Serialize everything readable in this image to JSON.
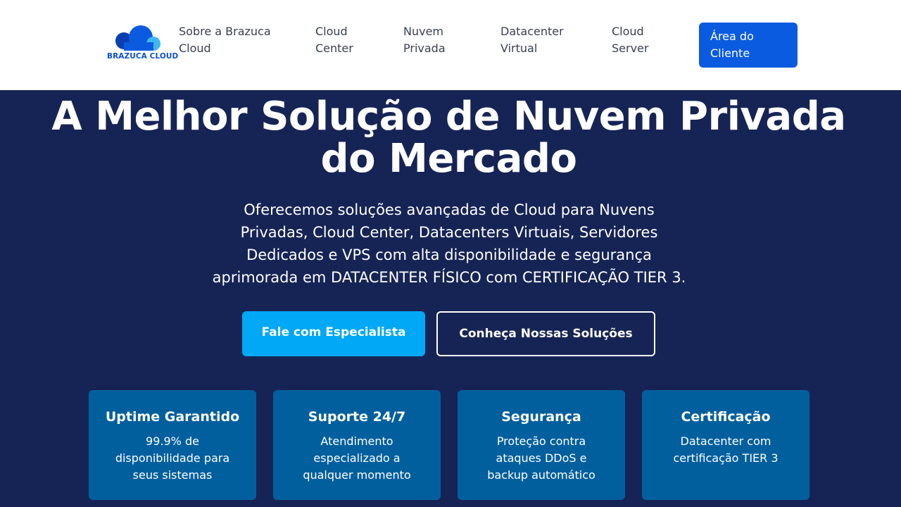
{
  "brand": {
    "logo_text": "BRAZUCA CLOUD",
    "colors": {
      "primary": "#0b5be0",
      "accent": "#00a8f5",
      "hero_bg": "#162455",
      "card_bg": "#025f9e"
    }
  },
  "nav": {
    "links": [
      "Sobre a Brazuca\nCloud",
      "Cloud\nCenter",
      "Nuvem\nPrivada",
      "Datacenter\nVirtual",
      "Cloud\nServer"
    ],
    "client_button": "Área do\nCliente"
  },
  "hero": {
    "title_line1": "A Melhor Solução de Nuvem Privada",
    "title_line2": "do Mercado",
    "subtitle": "Oferecemos soluções avançadas de Cloud para Nuvens\nPrivadas, Cloud Center, Datacenters Virtuais, Servidores\nDedicados e VPS com alta disponibilidade e segurança\naprimorada em DATACENTER FÍSICO com CERTIFICAÇÃO TIER 3.",
    "cta_primary": "Fale com Especialista",
    "cta_secondary": "Conheça Nossas Soluções"
  },
  "features": [
    {
      "title": "Uptime Garantido",
      "text": "99.9% de\ndisponibilidade para\nseus sistemas"
    },
    {
      "title": "Suporte 24/7",
      "text": "Atendimento\nespecializado a\nqualquer momento"
    },
    {
      "title": "Segurança",
      "text": "Proteção contra\nataques DDoS e\nbackup automático"
    },
    {
      "title": "Certificação",
      "text": "Datacenter com\ncertificação TIER 3"
    }
  ]
}
